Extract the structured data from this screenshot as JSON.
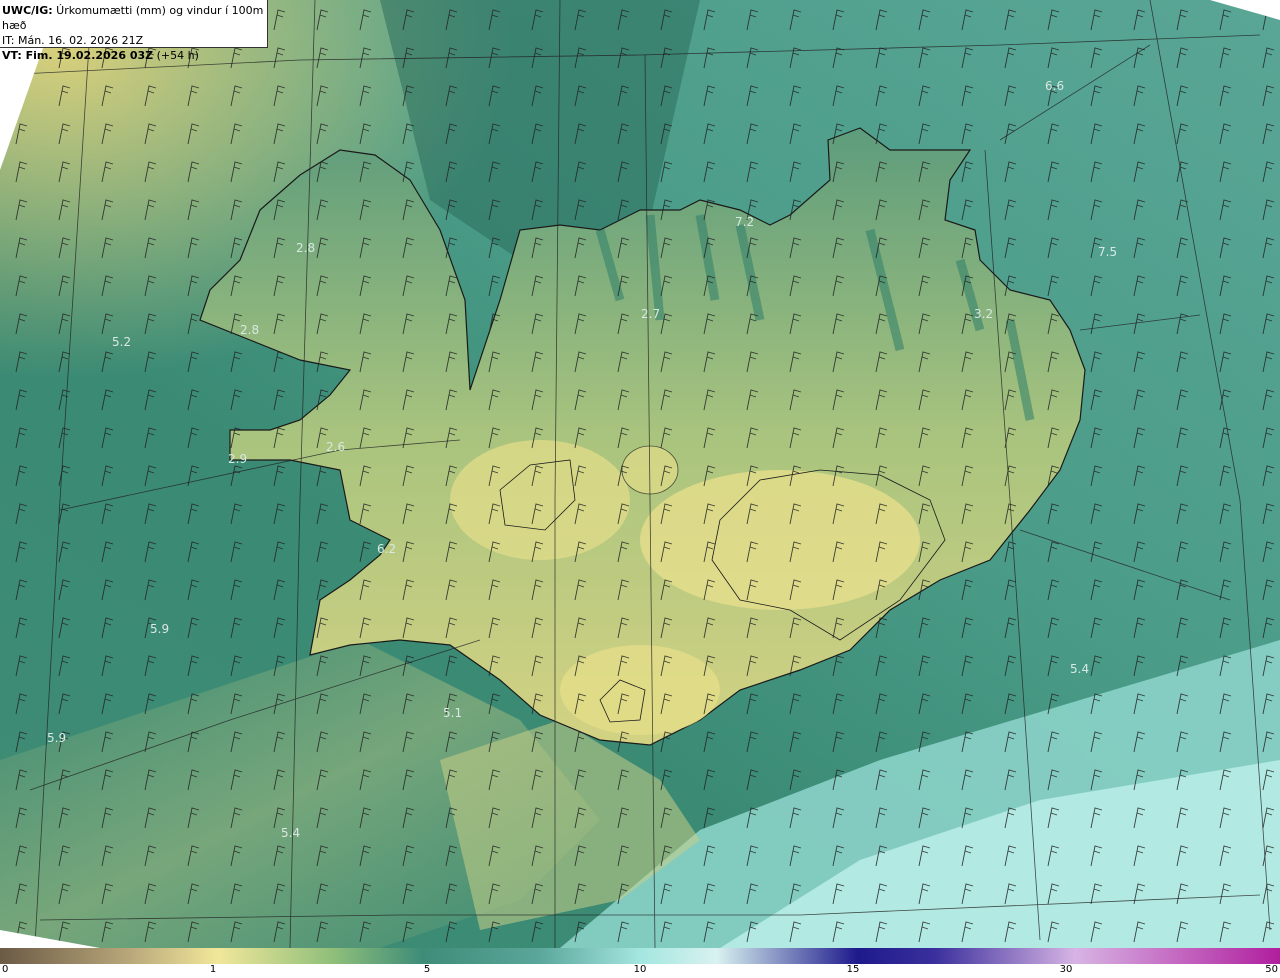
{
  "header": {
    "title_prefix": "UWC/IG:",
    "title_text": " Úrkomumætti (mm) og vindur í 100m hæð",
    "it_line": "IT: Mán. 16. 02. 2026 21Z",
    "vt_prefix": "VT: Fim. 19.02.2026 03Z",
    "vt_suffix": " (+54 h)"
  },
  "colorbar": {
    "stops": [
      "#6b5a45",
      "#b8a67a",
      "#f1e79a",
      "#8fbf7a",
      "#3e8c78",
      "#5aa69a",
      "#a4e6e0",
      "#d8f2f0",
      "#1e1a8c",
      "#d7b4e4",
      "#b01e9e"
    ],
    "ticks": [
      "0",
      "1",
      "5",
      "10",
      "15",
      "30",
      "50"
    ]
  },
  "map_labels": [
    {
      "text": "6.6"
    },
    {
      "text": "7.2"
    },
    {
      "text": "7.5"
    },
    {
      "text": "2.8"
    },
    {
      "text": "2.8"
    },
    {
      "text": "5.2"
    },
    {
      "text": "2.7"
    },
    {
      "text": "3.2"
    },
    {
      "text": "2.9"
    },
    {
      "text": "2.6"
    },
    {
      "text": "6.2"
    },
    {
      "text": "5.9"
    },
    {
      "text": "5.9"
    },
    {
      "text": "5.1"
    },
    {
      "text": "5.4"
    },
    {
      "text": "5.4"
    }
  ],
  "colors": {
    "land_low": "#e3dd8a",
    "land_mid": "#9cbf7c",
    "sea_dark": "#2f7a64",
    "sea_light": "#a8e8e2",
    "coast": "#1a1a1a"
  }
}
